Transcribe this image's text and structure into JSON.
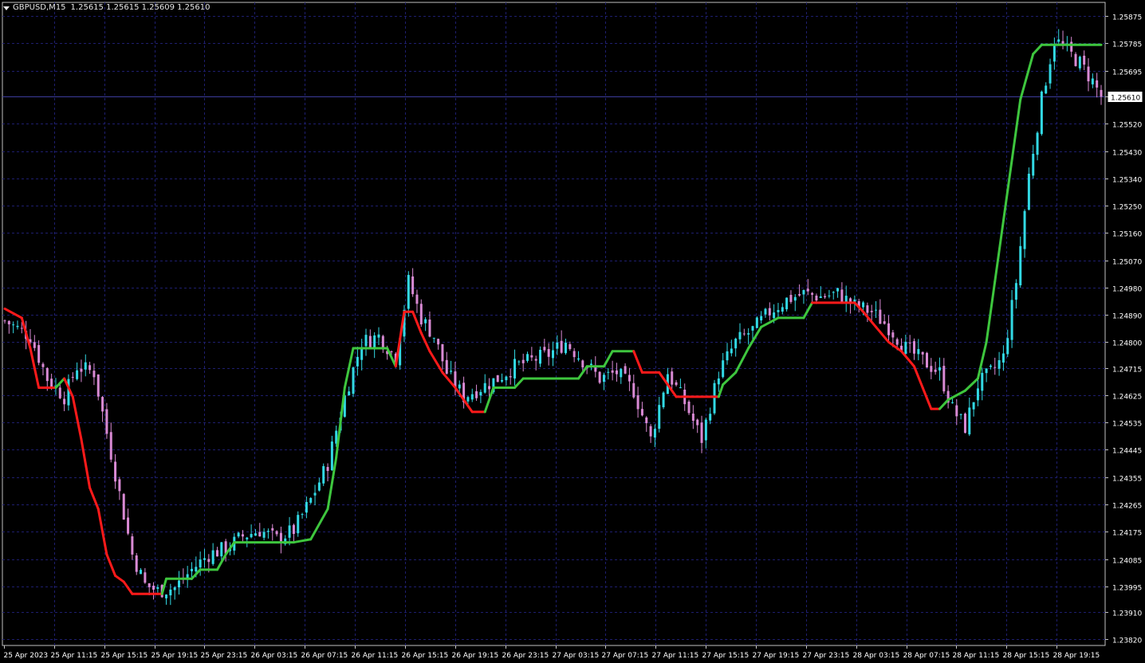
{
  "header": {
    "symbol": "GBPUSD,M15",
    "ohlc": "1.25615 1.25615 1.25609 1.25610",
    "dropdown_icon": "triangle-down-icon"
  },
  "colors": {
    "background": "#000000",
    "grid": "#1e1e6e",
    "axis": "#c0c0c0",
    "text": "#ffffff",
    "candle_up": "#32d9e4",
    "candle_down": "#d98ad4",
    "trend_up": "#3ec63e",
    "trend_down": "#ff1a1a",
    "price_line": "#3c3c9c"
  },
  "chart_data": {
    "type": "line",
    "title": "GBPUSD,M15",
    "current_price": 1.2561,
    "price_axis_ticks": [
      1.25875,
      1.25785,
      1.25695,
      1.2561,
      1.2552,
      1.2543,
      1.2534,
      1.2525,
      1.2516,
      1.2507,
      1.2498,
      1.2489,
      1.248,
      1.24715,
      1.24625,
      1.24535,
      1.24445,
      1.24355,
      1.24265,
      1.24175,
      1.24085,
      1.23995,
      1.2391,
      1.2382
    ],
    "time_axis_labels": [
      "25 Apr 2023",
      "25 Apr 11:15",
      "25 Apr 15:15",
      "25 Apr 19:15",
      "25 Apr 23:15",
      "26 Apr 03:15",
      "26 Apr 07:15",
      "26 Apr 11:15",
      "26 Apr 15:15",
      "26 Apr 19:15",
      "26 Apr 23:15",
      "27 Apr 03:15",
      "27 Apr 07:15",
      "27 Apr 11:15",
      "27 Apr 15:15",
      "27 Apr 19:15",
      "27 Apr 23:15",
      "28 Apr 03:15",
      "28 Apr 07:15",
      "28 Apr 11:15",
      "28 Apr 15:15",
      "28 Apr 19:15"
    ],
    "ylim": [
      1.238,
      1.2592
    ],
    "grid": true,
    "series": [
      {
        "kind": "candles",
        "close_path": [
          [
            0,
            1.2487
          ],
          [
            6,
            1.2482
          ],
          [
            10,
            1.2468
          ],
          [
            14,
            1.2462
          ],
          [
            17,
            1.2472
          ],
          [
            21,
            1.247
          ],
          [
            24,
            1.245
          ],
          [
            27,
            1.243
          ],
          [
            30,
            1.241
          ],
          [
            33,
            1.24
          ],
          [
            36,
            1.2398
          ],
          [
            40,
            1.2399
          ],
          [
            44,
            1.2405
          ],
          [
            48,
            1.241
          ],
          [
            52,
            1.2412
          ],
          [
            56,
            1.2416
          ],
          [
            60,
            1.2418
          ],
          [
            64,
            1.2415
          ],
          [
            68,
            1.2418
          ],
          [
            72,
            1.2428
          ],
          [
            76,
            1.244
          ],
          [
            80,
            1.2462
          ],
          [
            84,
            1.248
          ],
          [
            88,
            1.2482
          ],
          [
            92,
            1.2475
          ],
          [
            95,
            1.25
          ],
          [
            98,
            1.2488
          ],
          [
            101,
            1.2482
          ],
          [
            104,
            1.247
          ],
          [
            108,
            1.2462
          ],
          [
            112,
            1.2465
          ],
          [
            116,
            1.2468
          ],
          [
            120,
            1.2472
          ],
          [
            124,
            1.2474
          ],
          [
            128,
            1.2476
          ],
          [
            132,
            1.248
          ],
          [
            136,
            1.2474
          ],
          [
            140,
            1.2468
          ],
          [
            144,
            1.247
          ],
          [
            148,
            1.2464
          ],
          [
            152,
            1.2448
          ],
          [
            156,
            1.247
          ],
          [
            160,
            1.246
          ],
          [
            164,
            1.2448
          ],
          [
            168,
            1.247
          ],
          [
            172,
            1.248
          ],
          [
            176,
            1.2484
          ],
          [
            180,
            1.249
          ],
          [
            184,
            1.2494
          ],
          [
            188,
            1.2496
          ],
          [
            192,
            1.2495
          ],
          [
            196,
            1.2496
          ],
          [
            200,
            1.2492
          ],
          [
            204,
            1.249
          ],
          [
            208,
            1.2485
          ],
          [
            212,
            1.2478
          ],
          [
            216,
            1.2474
          ],
          [
            220,
            1.247
          ],
          [
            223,
            1.2458
          ],
          [
            226,
            1.2452
          ],
          [
            229,
            1.2466
          ],
          [
            232,
            1.247
          ],
          [
            235,
            1.2475
          ],
          [
            238,
            1.25
          ],
          [
            241,
            1.2535
          ],
          [
            244,
            1.256
          ],
          [
            247,
            1.258
          ],
          [
            250,
            1.2576
          ],
          [
            253,
            1.2572
          ],
          [
            256,
            1.2566
          ],
          [
            258,
            1.2561
          ]
        ]
      },
      {
        "kind": "trend-line",
        "points": [
          [
            0,
            1.2491,
            "down"
          ],
          [
            4,
            1.2488,
            "down"
          ],
          [
            6,
            1.2478,
            "down"
          ],
          [
            8,
            1.2465,
            "down"
          ],
          [
            12,
            1.2465,
            "down"
          ],
          [
            14,
            1.2468,
            "up"
          ],
          [
            16,
            1.2462,
            "down"
          ],
          [
            18,
            1.2448,
            "down"
          ],
          [
            20,
            1.2432,
            "down"
          ],
          [
            22,
            1.2425,
            "down"
          ],
          [
            24,
            1.241,
            "down"
          ],
          [
            26,
            1.2403,
            "down"
          ],
          [
            28,
            1.2401,
            "down"
          ],
          [
            30,
            1.2397,
            "down"
          ],
          [
            37,
            1.2397,
            "down"
          ],
          [
            38,
            1.2402,
            "up"
          ],
          [
            44,
            1.2402,
            "up"
          ],
          [
            46,
            1.2405,
            "up"
          ],
          [
            50,
            1.2405,
            "up"
          ],
          [
            52,
            1.241,
            "up"
          ],
          [
            54,
            1.2414,
            "up"
          ],
          [
            68,
            1.2414,
            "up"
          ],
          [
            72,
            1.2415,
            "up"
          ],
          [
            76,
            1.2425,
            "up"
          ],
          [
            78,
            1.2442,
            "up"
          ],
          [
            80,
            1.2465,
            "up"
          ],
          [
            82,
            1.2478,
            "up"
          ],
          [
            90,
            1.2478,
            "up"
          ],
          [
            92,
            1.2472,
            "up"
          ],
          [
            94,
            1.249,
            "down"
          ],
          [
            96,
            1.249,
            "down"
          ],
          [
            98,
            1.2483,
            "down"
          ],
          [
            100,
            1.2477,
            "down"
          ],
          [
            103,
            1.247,
            "down"
          ],
          [
            106,
            1.2465,
            "down"
          ],
          [
            110,
            1.2457,
            "down"
          ],
          [
            113,
            1.2457,
            "down"
          ],
          [
            115,
            1.2465,
            "up"
          ],
          [
            120,
            1.2465,
            "up"
          ],
          [
            122,
            1.2468,
            "up"
          ],
          [
            135,
            1.2468,
            "up"
          ],
          [
            137,
            1.2472,
            "up"
          ],
          [
            141,
            1.2472,
            "up"
          ],
          [
            143,
            1.2477,
            "up"
          ],
          [
            148,
            1.2477,
            "up"
          ],
          [
            150,
            1.247,
            "down"
          ],
          [
            154,
            1.247,
            "down"
          ],
          [
            156,
            1.2466,
            "down"
          ],
          [
            158,
            1.2462,
            "down"
          ],
          [
            168,
            1.2462,
            "down"
          ],
          [
            169,
            1.2466,
            "up"
          ],
          [
            172,
            1.247,
            "up"
          ],
          [
            175,
            1.2478,
            "up"
          ],
          [
            178,
            1.2485,
            "up"
          ],
          [
            182,
            1.2488,
            "up"
          ],
          [
            188,
            1.2488,
            "up"
          ],
          [
            190,
            1.2493,
            "up"
          ],
          [
            200,
            1.2493,
            "down"
          ],
          [
            202,
            1.249,
            "down"
          ],
          [
            205,
            1.2485,
            "down"
          ],
          [
            208,
            1.248,
            "down"
          ],
          [
            211,
            1.2477,
            "down"
          ],
          [
            214,
            1.2472,
            "down"
          ],
          [
            216,
            1.2465,
            "down"
          ],
          [
            218,
            1.2458,
            "down"
          ],
          [
            220,
            1.2458,
            "down"
          ],
          [
            222,
            1.2461,
            "up"
          ],
          [
            226,
            1.2464,
            "up"
          ],
          [
            229,
            1.2468,
            "up"
          ],
          [
            231,
            1.248,
            "up"
          ],
          [
            233,
            1.25,
            "up"
          ],
          [
            236,
            1.253,
            "up"
          ],
          [
            239,
            1.256,
            "up"
          ],
          [
            242,
            1.2575,
            "up"
          ],
          [
            244,
            1.2578,
            "up"
          ],
          [
            258,
            1.2578,
            "up"
          ]
        ]
      }
    ]
  }
}
